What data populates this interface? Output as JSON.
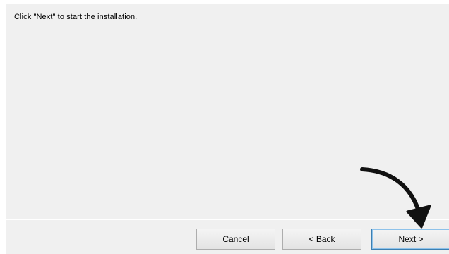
{
  "wizard": {
    "instruction": "Click \"Next\" to start the installation."
  },
  "buttons": {
    "cancel_label": "Cancel",
    "back_label": "< Back",
    "next_label": "Next >"
  },
  "annotation": {
    "icon": "curved-arrow-icon",
    "color": "#111111"
  },
  "colors": {
    "dialog_background": "#f0f0f0",
    "next_button_focus_border": "#3c7fb1"
  }
}
